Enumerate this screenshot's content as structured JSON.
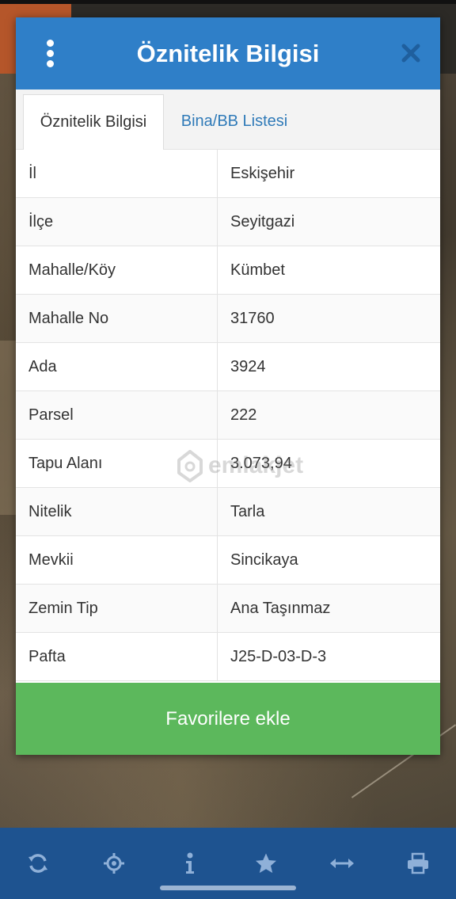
{
  "dialog": {
    "title": "Öznitelik Bilgisi",
    "tabs": [
      {
        "label": "Öznitelik Bilgisi",
        "active": true
      },
      {
        "label": "Bina/BB Listesi",
        "active": false
      }
    ],
    "rows": [
      {
        "key": "İl",
        "value": "Eskişehir"
      },
      {
        "key": "İlçe",
        "value": "Seyitgazi"
      },
      {
        "key": "Mahalle/Köy",
        "value": "Kümbet"
      },
      {
        "key": "Mahalle No",
        "value": "31760"
      },
      {
        "key": "Ada",
        "value": "3924"
      },
      {
        "key": "Parsel",
        "value": "222"
      },
      {
        "key": "Tapu Alanı",
        "value": "3.073,94"
      },
      {
        "key": "Nitelik",
        "value": "Tarla"
      },
      {
        "key": "Mevkii",
        "value": "Sincikaya"
      },
      {
        "key": "Zemin Tip",
        "value": "Ana Taşınmaz"
      },
      {
        "key": "Pafta",
        "value": "J25-D-03-D-3"
      }
    ],
    "favorite_label": "Favorilere ekle"
  },
  "watermark": "emlakjet",
  "toolbar": {
    "icons": [
      "refresh-icon",
      "locate-icon",
      "info-icon",
      "star-icon",
      "measure-icon",
      "print-icon"
    ]
  },
  "colors": {
    "header": "#2f7fc8",
    "favorite": "#5cb85c",
    "toolbar": "#1e5390"
  }
}
